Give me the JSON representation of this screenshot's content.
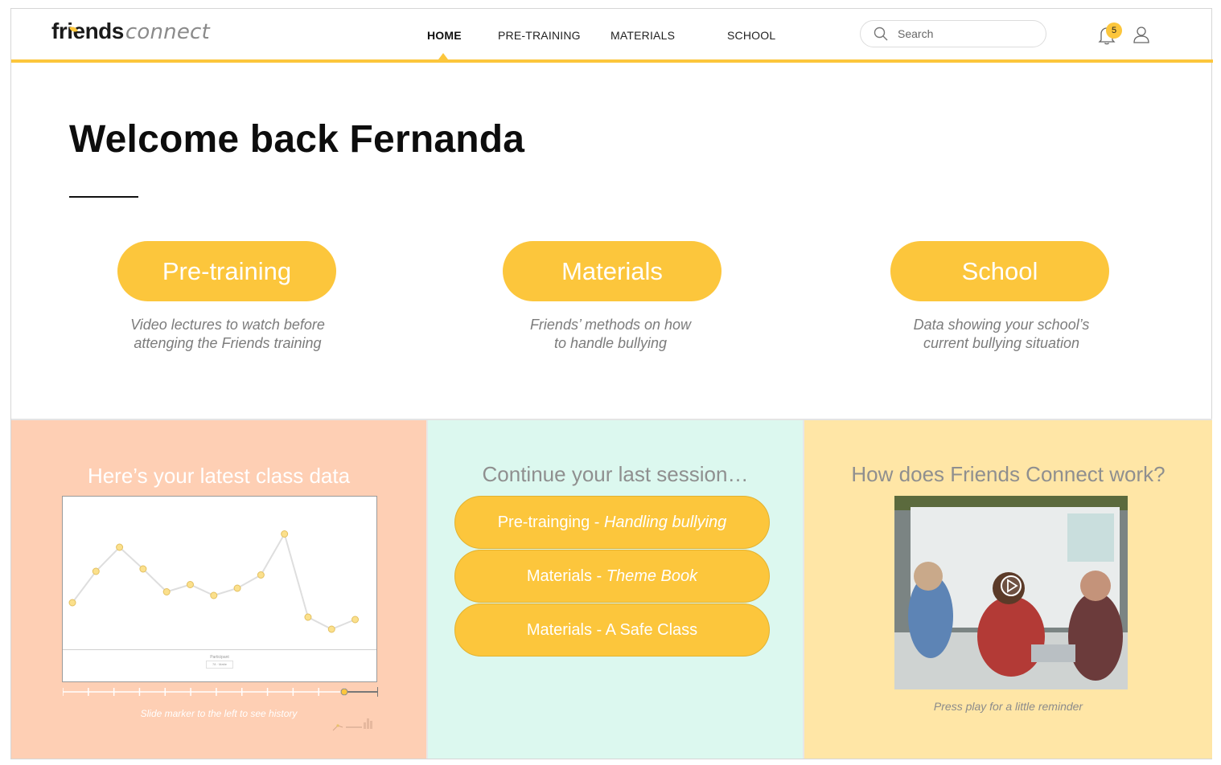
{
  "brand": {
    "bold": "friends",
    "light": "connect"
  },
  "nav": {
    "home": "HOME",
    "pretraining": "PRE-TRAINING",
    "materials": "MATERIALS",
    "school": "SCHOOL",
    "active": "home"
  },
  "search": {
    "placeholder": "Search",
    "value": ""
  },
  "notifications": {
    "count": "5"
  },
  "welcome": {
    "title": "Welcome back Fernanda"
  },
  "sections": [
    {
      "label": "Pre-training",
      "desc_line1": "Video lectures to watch before",
      "desc_line2": "attenging the Friends training"
    },
    {
      "label": "Materials",
      "desc_line1": "Friends’ methods on how",
      "desc_line2": "to handle bullying"
    },
    {
      "label": "School",
      "desc_line1": "Data showing your school’s",
      "desc_line2": "current bullying situation"
    }
  ],
  "class_data": {
    "title": "Here’s your latest class data",
    "slider_hint": "Slide marker to the left to see history"
  },
  "continue": {
    "title": "Continue your last session…",
    "items": [
      {
        "prefix": "Pre-trainging - ",
        "emph": "Handling bullying"
      },
      {
        "prefix": "Materials - ",
        "emph": "Theme Book"
      },
      {
        "prefix": "Materials - A Safe Class",
        "emph": ""
      }
    ]
  },
  "how": {
    "title": "How does Friends Connect work?",
    "caption": "Press play for a little reminder"
  },
  "colors": {
    "accent": "#fcc63c",
    "peach": "#fecfb4",
    "mint": "#dcf8ef",
    "cream": "#ffe6a6"
  },
  "chart_data": {
    "type": "line",
    "x": [
      1,
      2,
      3,
      4,
      5,
      6,
      7,
      8,
      9,
      10,
      11,
      12,
      13
    ],
    "values": [
      0.32,
      0.58,
      0.78,
      0.6,
      0.41,
      0.47,
      0.38,
      0.44,
      0.55,
      0.89,
      0.2,
      0.1,
      0.18
    ],
    "title": "",
    "xlabel": "",
    "ylabel": "",
    "ylim": [
      0,
      1
    ],
    "grid": false
  }
}
